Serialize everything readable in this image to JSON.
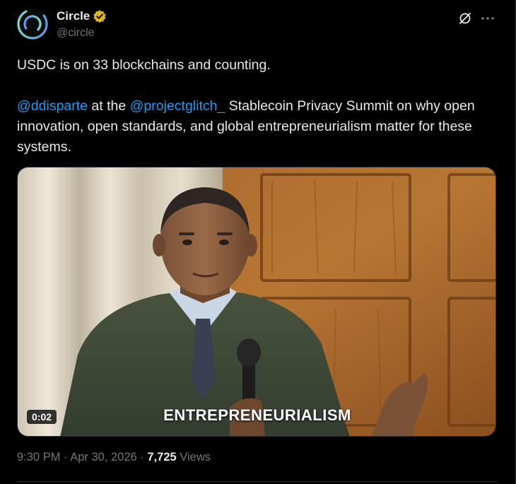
{
  "post": {
    "author": {
      "display_name": "Circle",
      "handle": "@circle",
      "verified_badge_color": "#e2b719",
      "avatar_icon": "circle-logo-icon",
      "avatar_colors": [
        "#5b8def",
        "#7de3c9"
      ]
    },
    "header_icons": [
      "grok-icon",
      "more-icon"
    ],
    "text": {
      "line1": "USDC is on 33 blockchains and counting.",
      "mention1": "@ddisparte",
      "mid1": " at the ",
      "mention2": "@projectglitch_",
      "rest": " Stablecoin Privacy Summit on why open innovation, open standards, and global entrepreneurialism matter for these systems."
    },
    "media": {
      "duration": "0:02",
      "caption": "ENTREPRENEURIALISM"
    },
    "meta": {
      "time": "9:30 PM",
      "separator": " · ",
      "date": "Apr 30, 2026",
      "views_count": "7,725",
      "views_label": " Views"
    }
  },
  "colors": {
    "background": "#000000",
    "text": "#e7e9ea",
    "secondary": "#71767b",
    "link": "#1d9bf0",
    "border": "#2f3336"
  }
}
